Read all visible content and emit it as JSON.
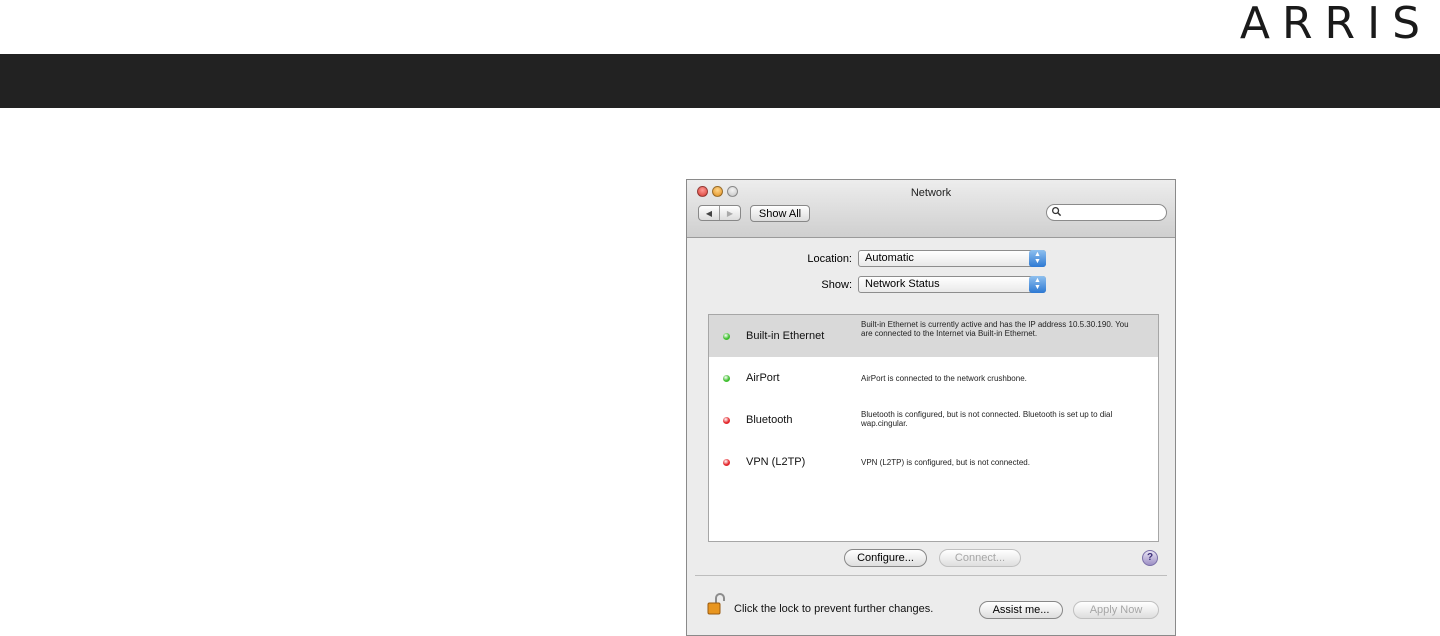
{
  "brand": {
    "logo_text": "ARRIS"
  },
  "window": {
    "title": "Network",
    "toolbar": {
      "show_all_label": "Show All",
      "search_placeholder": ""
    },
    "location": {
      "label": "Location:",
      "value": "Automatic"
    },
    "show": {
      "label": "Show:",
      "value": "Network Status"
    },
    "services": [
      {
        "name": "Built-in Ethernet",
        "status_color": "#3fbf2f",
        "selected": true,
        "description": "Built-in Ethernet is currently active and has the IP address 10.5.30.190. You are connected to the Internet via Built-in Ethernet."
      },
      {
        "name": "AirPort",
        "status_color": "#3fbf2f",
        "selected": false,
        "description": "AirPort is connected to the network crushbone."
      },
      {
        "name": "Bluetooth",
        "status_color": "#e3262b",
        "selected": false,
        "description": "Bluetooth is configured, but is not connected. Bluetooth is set up to dial wap.cingular."
      },
      {
        "name": "VPN (L2TP)",
        "status_color": "#e3262b",
        "selected": false,
        "description": "VPN (L2TP) is configured, but is not connected."
      }
    ],
    "buttons": {
      "configure": "Configure...",
      "connect": "Connect...",
      "help": "?",
      "assist": "Assist me...",
      "apply": "Apply Now"
    },
    "lock_text": "Click the lock to prevent further changes."
  },
  "colors": {
    "header_band": "#222222",
    "close": "#e0443e",
    "minimize": "#e8a22e",
    "zoom": "#cfcfcf"
  }
}
